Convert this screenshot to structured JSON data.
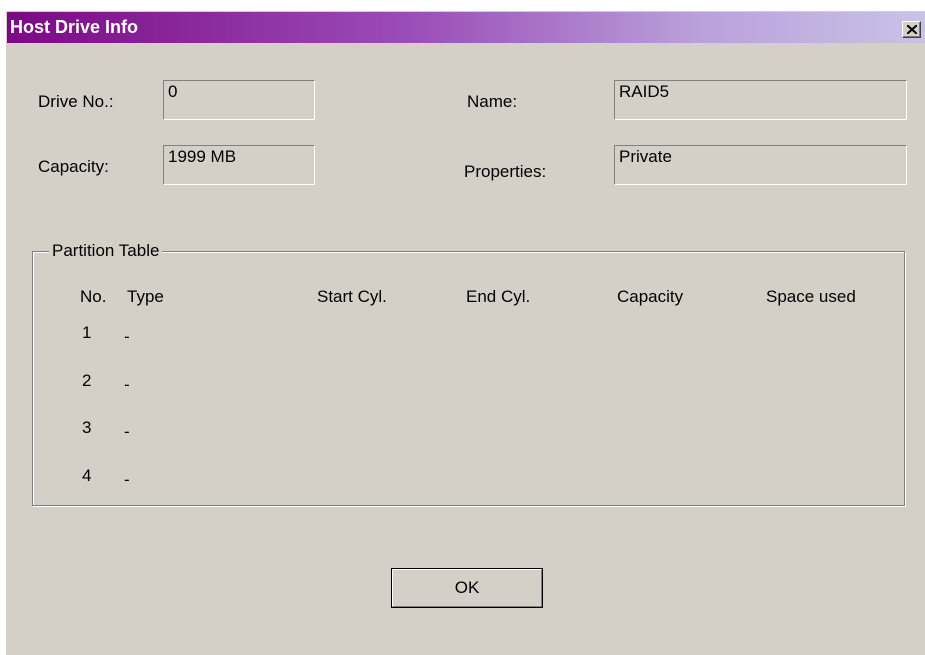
{
  "window": {
    "title": "Host Drive Info"
  },
  "icons": {
    "close": "close-icon"
  },
  "fields": {
    "drive_no_label": "Drive No.:",
    "drive_no_value": "0",
    "capacity_label": "Capacity:",
    "capacity_value": "1999 MB",
    "name_label": "Name:",
    "name_value": "RAID5",
    "properties_label": "Properties:",
    "properties_value": "Private"
  },
  "partition_table": {
    "caption": "Partition Table",
    "columns": [
      "No.",
      "Type",
      "Start Cyl.",
      "End Cyl.",
      "Capacity",
      "Space used"
    ],
    "rows": [
      {
        "no": "1",
        "type": "-"
      },
      {
        "no": "2",
        "type": "-"
      },
      {
        "no": "3",
        "type": "-"
      },
      {
        "no": "4",
        "type": "-"
      }
    ]
  },
  "buttons": {
    "ok_label": "OK"
  },
  "colors": {
    "titlebar_start": "#7a0a84",
    "titlebar_end": "#c9c2e8",
    "face": "#d4d0c8"
  }
}
